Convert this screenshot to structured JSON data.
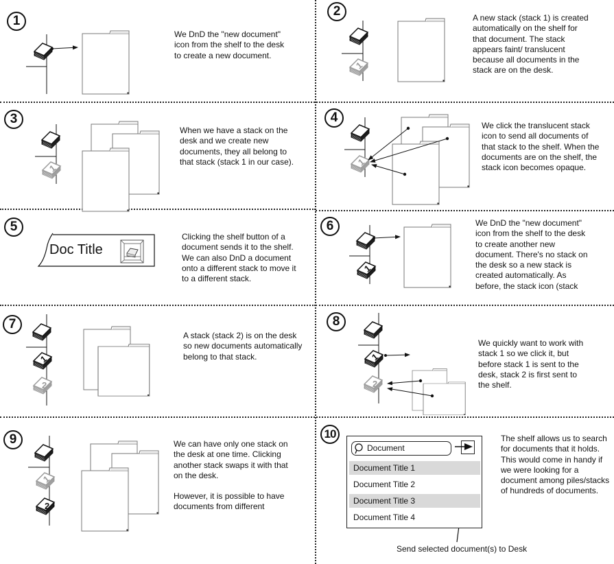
{
  "panels": [
    {
      "number": "1",
      "text": "We DnD the \"new document\" icon from the shelf to the desk to create a new document."
    },
    {
      "number": "2",
      "text": "A new stack (stack 1) is created automatically on the shelf for that document. The stack appears faint/ translucent because all documents in the stack are on the desk."
    },
    {
      "number": "3",
      "text": "When we have a stack on the desk and we create new documents, they all belong to that stack (stack 1 in our case)."
    },
    {
      "number": "4",
      "text": "We click the translucent stack icon to send all documents of that stack to the shelf. When the documents are on the shelf, the stack icon becomes opaque."
    },
    {
      "number": "5",
      "text": "Clicking the shelf button of a document sends it to the shelf. We can also DnD a document onto a different stack to move it to a different stack.",
      "doc_title": "Doc Title"
    },
    {
      "number": "6",
      "text": "We DnD the \"new document\" icon from the shelf to the desk to create another new document. There's no stack on the desk so a new stack is created automatically. As before, the stack icon (stack"
    },
    {
      "number": "7",
      "text": "A stack (stack 2) is on the desk so new documents automatically belong to that stack."
    },
    {
      "number": "8",
      "text": "We quickly want to work with stack 1 so we click it, but before stack 1 is sent to the desk, stack 2 is first sent to the shelf."
    },
    {
      "number": "9",
      "text": "We can have only one stack on the desk at one time. Clicking another stack swaps it with that on the desk.",
      "text2": "However, it is possible to have documents from different"
    },
    {
      "number": "10",
      "text": "The shelf allows us to search for documents that it holds. This would come in handy if we were looking for a document among piles/stacks of hundreds of documents."
    }
  ],
  "stack_labels": {
    "stack1": "1",
    "stack2": "2"
  },
  "shelf": {
    "search_value": "Document",
    "send_button_caption": "Send selected document(s) to Desk",
    "items": [
      {
        "label": "Document Title 1",
        "selected": true
      },
      {
        "label": "Document Title 2",
        "selected": false
      },
      {
        "label": "Document Title 3",
        "selected": true
      },
      {
        "label": "Document Title 4",
        "selected": false
      }
    ]
  },
  "colors": {
    "ink": "#111111",
    "faint": "#9a9a9a",
    "selected_row": "#d9d9d9",
    "doc_border": "#777777"
  }
}
